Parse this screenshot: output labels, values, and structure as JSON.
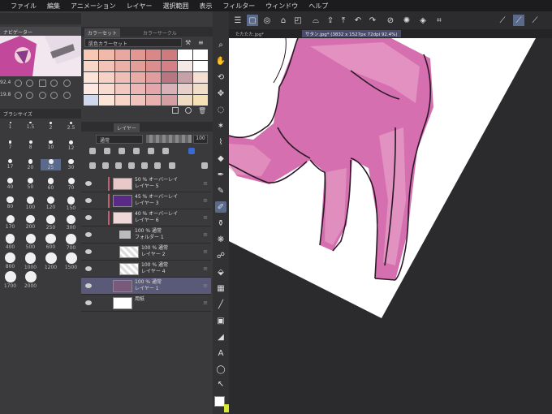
{
  "menu": [
    "ファイル",
    "編集",
    "アニメーション",
    "レイヤー",
    "選択範囲",
    "表示",
    "フィルター",
    "ウィンドウ",
    "ヘルプ"
  ],
  "navigator": {
    "title": "ナビゲーター",
    "zoom": "92.4",
    "angle": "19.8"
  },
  "colorset": {
    "tab1": "カラーセット",
    "tab2": "カラーサークル",
    "preset": "肌色カラーセット",
    "swatches": [
      "#f7c9b5",
      "#f0b9a8",
      "#e9a79f",
      "#e2978f",
      "#d98787",
      "#cf7a7f",
      "#ffffff",
      "#ffffff",
      "#f8d6c7",
      "#f2c3b6",
      "#ebb0a6",
      "#e49e98",
      "#dc8e8e",
      "#d48086",
      "#f5e7e3",
      "#ffffff",
      "#fbe3d8",
      "#f6d1c6",
      "#efbeb6",
      "#e8aca7",
      "#e19c9d",
      "#b87683",
      "#c7a1a8",
      "#f3e0d3",
      "#fde9e1",
      "#f8dad1",
      "#f2c8c0",
      "#ebb6b4",
      "#e4a6aa",
      "#d9b1b6",
      "#e9cfc9",
      "#f1dec9",
      "#cfd8ec",
      "#fbe3d6",
      "#f7d3c8",
      "#f0c3bb",
      "#e9b1ae",
      "#d49ea2",
      "#efdbc1",
      "#f5e1b3"
    ]
  },
  "brush": {
    "title": "ブラシサイズ",
    "rows": [
      [
        "1",
        "1.5",
        "2",
        "2.5"
      ],
      [
        "7",
        "8",
        "10",
        "12"
      ],
      [
        "17",
        "20",
        "25",
        "30"
      ],
      [
        "40",
        "50",
        "60",
        "70"
      ],
      [
        "80",
        "100",
        "120",
        "150"
      ],
      [
        "170",
        "200",
        "250",
        "300"
      ],
      [
        "400",
        "500",
        "600",
        "700"
      ],
      [
        "800",
        "1000",
        "1200",
        "1500"
      ],
      [
        "1700",
        "2000"
      ]
    ]
  },
  "layers": {
    "title": "レイヤー",
    "blend": "通常",
    "opacity": "100",
    "items": [
      {
        "line1": "50 % オーバーレイ",
        "line2": "レイヤー 5",
        "thumb": "#e8c8c8"
      },
      {
        "line1": "45 % オーバーレイ",
        "line2": "レイヤー 3",
        "thumb": "#5a2a88"
      },
      {
        "line1": "40 % オーバーレイ",
        "line2": "レイヤー 6",
        "thumb": "#f0d8d8"
      },
      {
        "line1": "100 % 通常",
        "line2": "フォルダー 1",
        "thumb": "folder"
      },
      {
        "line1": "100 % 通常",
        "line2": "レイヤー 2",
        "thumb": "#eeeeee"
      },
      {
        "line1": "100 % 通常",
        "line2": "レイヤー 4",
        "thumb": "#eeeeee"
      },
      {
        "line1": "100 % 通常",
        "line2": "レイヤー 1",
        "thumb": "#7a5a7a"
      },
      {
        "line1": "",
        "line2": "用紙",
        "thumb": "#ffffff"
      }
    ]
  },
  "tabs": [
    {
      "label": "たたたた.jpg*"
    },
    {
      "label": "サタン.jpg* (3832 x 1527px 72dpi 92.4%)"
    }
  ],
  "colors": {
    "accent": "#5a6a8a",
    "selected_layer": "#5a5a78",
    "skin_pink": "#d36bb0"
  }
}
